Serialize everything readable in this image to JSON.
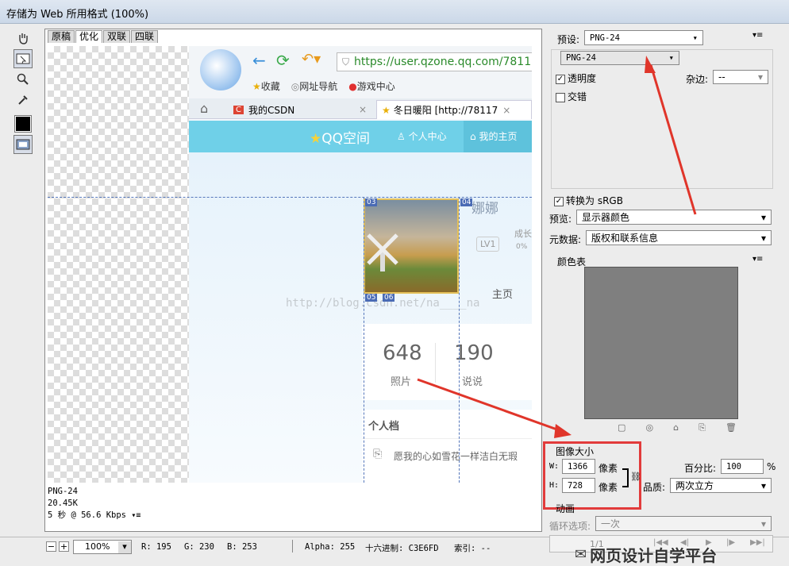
{
  "window": {
    "title": "存储为 Web 所用格式 (100%)"
  },
  "tabs": [
    "原稿",
    "优化",
    "双联",
    "四联"
  ],
  "browser": {
    "url": "https://user.qzone.qq.com/78117",
    "bookmarks": [
      "收藏",
      "网址导航",
      "游戏中心"
    ],
    "tab1": "我的CSDN",
    "tab2": "冬日暖阳 [http://78117",
    "qzone_brand": "QQ空间",
    "nav_personal": "个人中心",
    "nav_home": "我的主页",
    "nickname": "娜娜",
    "level": "LV1",
    "growth": "成长",
    "growth_pct": "0%",
    "home_link": "主页",
    "stat1_num": "648",
    "stat1_label": "照片",
    "stat2_num": "190",
    "stat2_label": "说说",
    "profile_title": "个人档",
    "profile_text": "愿我的心如雪花一样洁白无瑕",
    "watermark": "http://blog.csdn.net/na____na",
    "slice_labels": [
      "03",
      "04",
      "05",
      "06"
    ]
  },
  "info": {
    "format": "PNG-24",
    "size": "20.45K",
    "time": "5 秒 @ 56.6 Kbps"
  },
  "status": {
    "zoom": "100%",
    "r": "R: 195",
    "g": "G: 230",
    "b": "B: 253",
    "alpha": "Alpha: 255",
    "hex": "十六进制: C3E6FD",
    "index": "索引: --"
  },
  "panel": {
    "preset_label": "预设:",
    "preset_value": "PNG-24",
    "format_value": "PNG-24",
    "transparency": "透明度",
    "matte_label": "杂边:",
    "matte_value": "--",
    "interlaced": "交错",
    "convert_srgb": "转换为 sRGB",
    "preview_label": "预览:",
    "preview_value": "显示器颜色",
    "metadata_label": "元数据:",
    "metadata_value": "版权和联系信息",
    "color_table": "颜色表",
    "image_size": "图像大小",
    "w_label": "W:",
    "w_value": "1366",
    "w_unit": "像素",
    "h_label": "H:",
    "h_value": "728",
    "h_unit": "像素",
    "percent_label": "百分比:",
    "percent_value": "100",
    "percent_unit": "%",
    "quality_label": "品质:",
    "quality_value": "两次立方",
    "animation": "动画",
    "loop_label": "循环选项:",
    "loop_value": "一次",
    "frame": "1/1"
  },
  "wechat_watermark": "网页设计自学平台",
  "colors": {
    "qzone_bar": "#6fd0e8",
    "red": "#e23b3b",
    "swatch_gray": "#7f7f7f"
  }
}
